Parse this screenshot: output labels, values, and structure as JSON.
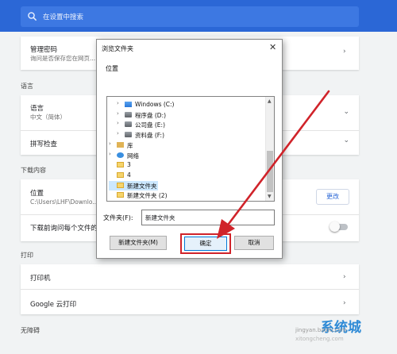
{
  "search": {
    "placeholder": "在设置中搜索"
  },
  "manage_password": {
    "title": "管理密码",
    "subtitle": "询问是否保存您在网页..."
  },
  "sections": {
    "language": "语言",
    "downloads": "下载内容",
    "print": "打印",
    "accessibility": "无障碍"
  },
  "language_row": {
    "title": "语言",
    "subtitle": "中文（简体）"
  },
  "spellcheck_row": {
    "title": "拼写检查"
  },
  "location_row": {
    "title": "位置",
    "subtitle": "C:\\Users\\LHF\\Downlo...",
    "change_label": "更改"
  },
  "ask_row": {
    "title": "下载前询问每个文件的..."
  },
  "printer_row": {
    "title": "打印机"
  },
  "cloudprint_row": {
    "title": "Google 云打印"
  },
  "dialog": {
    "title": "浏览文件夹",
    "close_glyph": "✕",
    "location_label": "位置",
    "tree": [
      {
        "label": "Windows (C:)",
        "icon": "windows-drive-icon",
        "expand": "›"
      },
      {
        "label": "程序盘 (D:)",
        "icon": "drive-icon",
        "expand": "›"
      },
      {
        "label": "公司盘 (E:)",
        "icon": "drive-icon",
        "expand": "›"
      },
      {
        "label": "资料盘 (F:)",
        "icon": "drive-icon",
        "expand": "›"
      },
      {
        "label": "库",
        "icon": "library-icon",
        "expand": "›"
      },
      {
        "label": "网络",
        "icon": "network-icon",
        "expand": "›"
      },
      {
        "label": "3",
        "icon": "folder-icon",
        "expand": ""
      },
      {
        "label": "4",
        "icon": "folder-icon",
        "expand": ""
      },
      {
        "label": "新建文件夹",
        "icon": "folder-icon",
        "expand": "",
        "selected": true
      },
      {
        "label": "新建文件夹 (2)",
        "icon": "folder-icon",
        "expand": ""
      }
    ],
    "folder_label": "文件夹(F):",
    "folder_value": "新建文件夹",
    "new_folder_button": "新建文件夹(M)",
    "ok_button": "确定",
    "cancel_button": "取消"
  },
  "colors": {
    "accent": "#2b67d6",
    "highlight": "#d0232a"
  },
  "watermark": {
    "site": "jingyan.baidu.com",
    "brand": "系统城",
    "url": "xitongcheng.com"
  }
}
